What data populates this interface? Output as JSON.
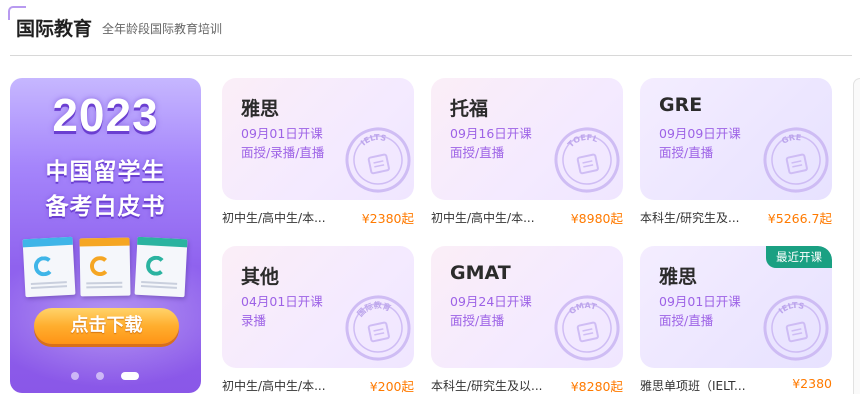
{
  "header": {
    "title": "国际教育",
    "subtitle": "全年龄段国际教育培训"
  },
  "banner": {
    "year": "2023",
    "line1": "中国留学生",
    "line2": "备考白皮书",
    "button": "点击下载",
    "carousel_dots": 3,
    "active_dot": 3
  },
  "cards": [
    {
      "name": "雅思",
      "date": "09月01日开课",
      "mode": "面授/录播/直播",
      "desc": "初中生/高中生/本...",
      "price": "¥2380起",
      "stamp": "IELTS",
      "bg": "pink"
    },
    {
      "name": "托福",
      "date": "09月16日开课",
      "mode": "面授/直播",
      "desc": "初中生/高中生/本...",
      "price": "¥8980起",
      "stamp": "TOEFL",
      "bg": "pink"
    },
    {
      "name": "GRE",
      "date": "09月09日开课",
      "mode": "面授/直播",
      "desc": "本科生/研究生及...",
      "price": "¥5266.7起",
      "stamp": "GRE",
      "bg": "lav"
    },
    {
      "name": "其他",
      "date": "04月01日开课",
      "mode": "录播",
      "desc": "初中生/高中生/本...",
      "price": "¥200起",
      "stamp": "国际教育",
      "bg": "pink"
    },
    {
      "name": "GMAT",
      "date": "09月24日开课",
      "mode": "面授/直播",
      "desc": "本科生/研究生及以...",
      "price": "¥8280起",
      "stamp": "GMAT",
      "bg": "pink"
    },
    {
      "name": "雅思",
      "date": "09月01日开课",
      "mode": "面授/直播",
      "desc": "雅思单项班（IELT...",
      "price": "¥2380",
      "stamp": "IELTS",
      "bg": "lav",
      "badge": "最近开课"
    }
  ],
  "colors": {
    "accent_purple": "#9d62e6",
    "price_orange": "#ff7a00",
    "badge_green": "#1aa082",
    "banner_purple": "#8f62ee"
  }
}
